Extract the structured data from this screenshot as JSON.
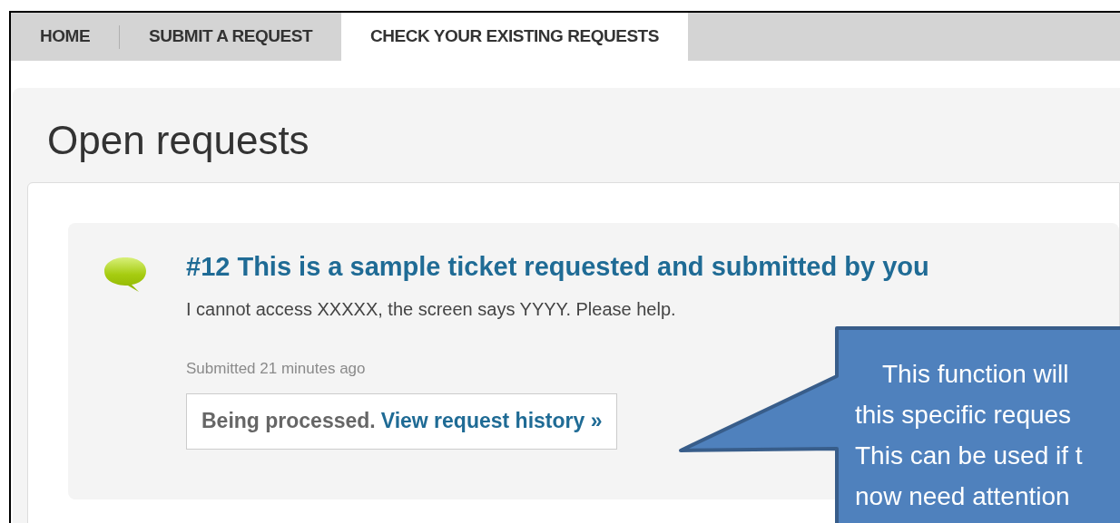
{
  "tabs": [
    {
      "label": "HOME",
      "selected": false
    },
    {
      "label": "SUBMIT A REQUEST",
      "selected": false
    },
    {
      "label": "CHECK YOUR EXISTING REQUESTS",
      "selected": true
    }
  ],
  "heading": "Open requests",
  "requests": [
    {
      "title": "#12 This is a sample ticket requested and submitted by you",
      "description": "I cannot access XXXXX, the screen says YYYY. Please help.",
      "submitted": "Submitted 21 minutes ago",
      "status": "Being processed.",
      "history_link": "View request history »"
    }
  ],
  "callout": {
    "lines": [
      "This function will",
      "this specific reques",
      "This can be used if t",
      "now need attention"
    ]
  }
}
